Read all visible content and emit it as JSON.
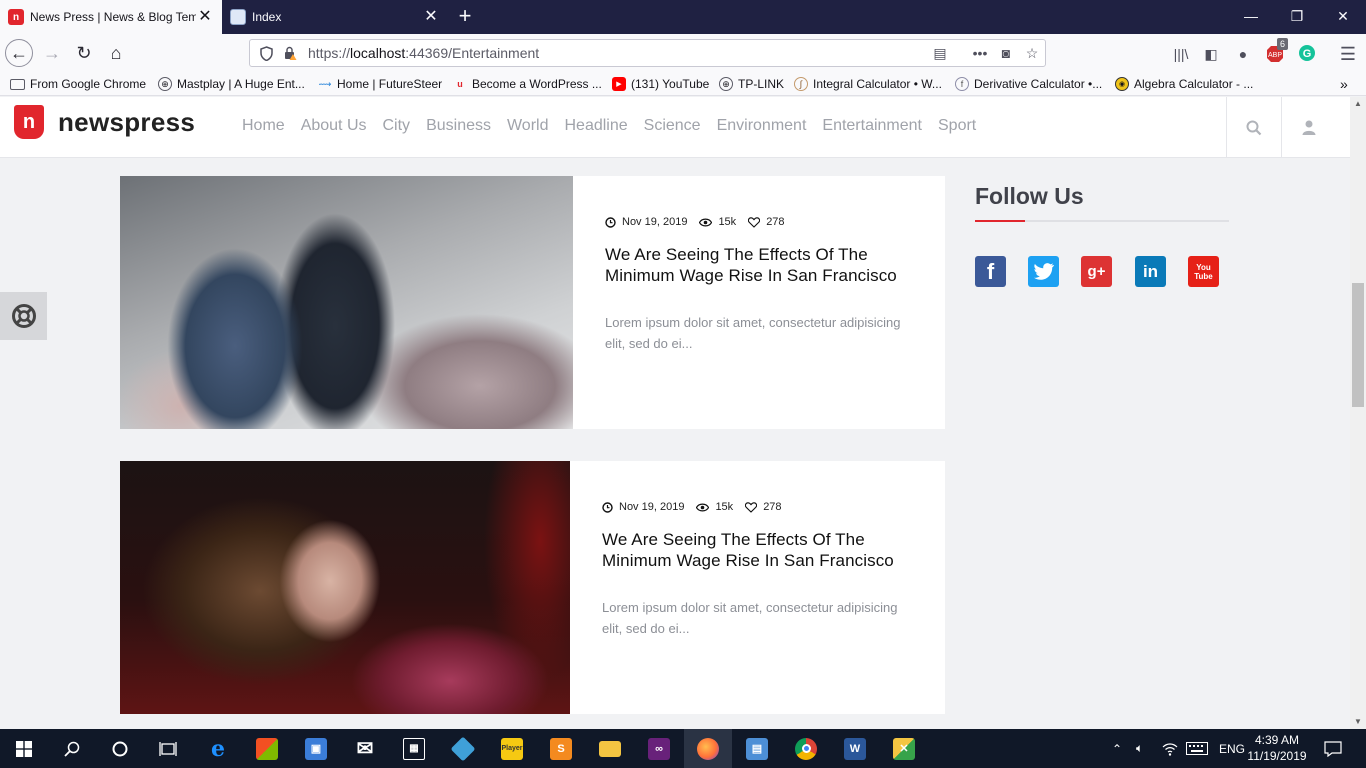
{
  "browser": {
    "tabs": [
      {
        "title": "News Press | News & Blog Temp",
        "active": true
      },
      {
        "title": "Index",
        "active": false
      }
    ],
    "url_prefix": "https://",
    "url_host": "localhost",
    "url_rest": ":44369/Entertainment",
    "bookmarks": [
      "From Google Chrome",
      "Mastplay | A Huge Ent...",
      "Home | FutureSteer",
      "Become a WordPress ...",
      "(131) YouTube",
      "TP-LINK",
      "Integral Calculator • W...",
      "Derivative Calculator •...",
      "Algebra Calculator - ..."
    ],
    "badge_count": "6"
  },
  "site": {
    "logo_text": "newspress",
    "logo_mark": "n",
    "nav": [
      "Home",
      "About Us",
      "City",
      "Business",
      "World",
      "Headline",
      "Science",
      "Environment",
      "Entertainment",
      "Sport"
    ]
  },
  "articles": [
    {
      "date": "Nov 19, 2019",
      "views": "15k",
      "likes": "278",
      "title": "We Are Seeing The Effects Of The Minimum Wage Rise In San Francisco",
      "excerpt": "Lorem ipsum dolor sit amet, consectetur adipisicing elit, sed do ei..."
    },
    {
      "date": "Nov 19, 2019",
      "views": "15k",
      "likes": "278",
      "title": "We Are Seeing The Effects Of The Minimum Wage Rise In San Francisco",
      "excerpt": "Lorem ipsum dolor sit amet, consectetur adipisicing elit, sed do ei..."
    }
  ],
  "sidebar": {
    "title": "Follow Us",
    "social": [
      {
        "name": "facebook",
        "glyph": "f",
        "color": "#3b5998"
      },
      {
        "name": "twitter",
        "glyph": "t",
        "color": "#1da1f2"
      },
      {
        "name": "google-plus",
        "glyph": "g+",
        "color": "#dd3333"
      },
      {
        "name": "linkedin",
        "glyph": "in",
        "color": "#0a7ab8"
      },
      {
        "name": "youtube",
        "glyph": "You Tube",
        "color": "#e62117"
      }
    ]
  },
  "taskbar": {
    "time": "4:39 AM",
    "date": "11/19/2019",
    "lang": "ENG"
  },
  "colors": {
    "brand_red": "#e1262d",
    "nav_text": "#a0a3aa",
    "tab_bar": "#1f2142"
  }
}
